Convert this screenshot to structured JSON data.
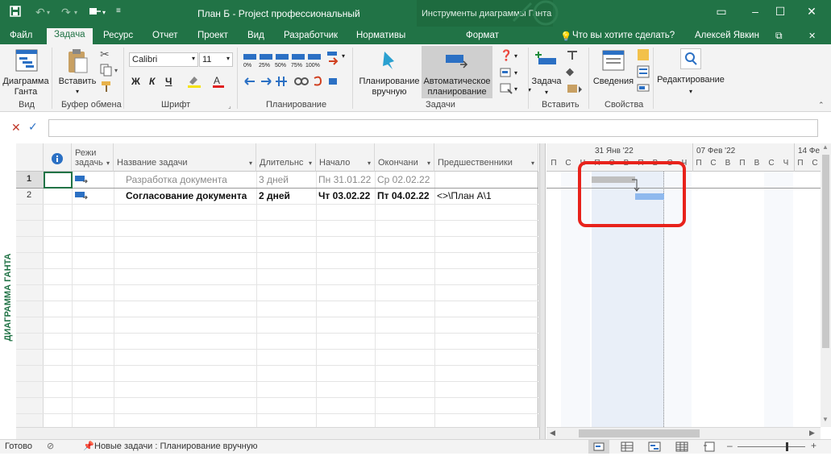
{
  "titlebar": {
    "title": "План Б - Project профессиональный",
    "context_tools": "Инструменты диаграммы Ганта"
  },
  "tabs": [
    "Файл",
    "Задача",
    "Ресурс",
    "Отчет",
    "Проект",
    "Вид",
    "Разработчик",
    "Нормативы",
    "Формат"
  ],
  "tell_me": "Что вы хотите сделать?",
  "user": "Алексей Явкин",
  "ribbon": {
    "gantt_btn": "Диаграмма Ганта",
    "gantt_btn_l1": "Диаграмма",
    "gantt_btn_l2": "Ганта",
    "paste_btn": "Вставить",
    "font_name": "Calibri",
    "font_size": "11",
    "bold": "Ж",
    "italic": "К",
    "underline": "Ч",
    "pct": [
      "0%",
      "25%",
      "50%",
      "75%",
      "100%"
    ],
    "manual_l1": "Планирование",
    "manual_l2": "вручную",
    "auto_l1": "Автоматическое",
    "auto_l2": "планирование",
    "task_btn": "Задача",
    "info_btn": "Сведения",
    "edit_btn": "Редактирование",
    "groups": {
      "view": "Вид",
      "clipboard": "Буфер обмена",
      "font": "Шрифт",
      "planning": "Планирование",
      "tasks": "Задачи",
      "insert": "Вставить",
      "properties": "Свойства"
    }
  },
  "side_label": "ДИАГРАММА ГАНТА",
  "columns": {
    "mode": "Режи",
    "mode2": "задачь",
    "name": "Название задачи",
    "duration": "Длительнс",
    "start": "Начало",
    "finish": "Окончани",
    "predecessors": "Предшественники"
  },
  "rows": [
    {
      "id": "1",
      "name": "Разработка документа",
      "duration": "3 дней",
      "start": "Пн 31.01.22",
      "finish": "Ср 02.02.22",
      "pred": ""
    },
    {
      "id": "2",
      "name": "Согласование документа",
      "duration": "2 дней",
      "start": "Чт 03.02.22",
      "finish": "Пт 04.02.22",
      "pred": "<>\\План А\\1"
    }
  ],
  "timescale": {
    "weeks": [
      "31 Янв '22",
      "07 Фев '22",
      "14 Фе"
    ],
    "days": [
      "П",
      "С",
      "Ч",
      "П",
      "С",
      "В",
      "П",
      "В",
      "С",
      "Ч",
      "П",
      "С",
      "В",
      "П",
      "В",
      "С",
      "Ч",
      "П",
      "С",
      "В",
      "П",
      "В"
    ]
  },
  "status": {
    "ready": "Готово",
    "new_tasks": "Новые задачи : Планирование вручную"
  },
  "colors": {
    "brand": "#217346",
    "highlight": "#e8221b",
    "bar_manual": "#bfbfbf",
    "bar_auto": "#8fb9ee"
  }
}
